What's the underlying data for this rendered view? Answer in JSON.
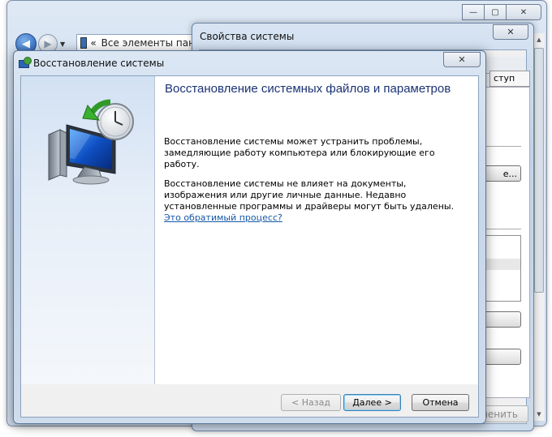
{
  "control_panel": {
    "address_text": "Все элементы панел",
    "address_chevron": "«"
  },
  "system_properties": {
    "title": "Свойства системы",
    "tab_fragment": "ступ",
    "button_fragment": "е...",
    "apply_label": "Применить"
  },
  "system_restore": {
    "title": "Восстановление системы",
    "heading": "Восстановление системных файлов и параметров",
    "paragraph1": "Восстановление системы может устранить проблемы, замедляющие работу компьютера или блокирующие его работу.",
    "paragraph2": "Восстановление системы не влияет на документы, изображения или другие личные данные. Недавно установленные программы и драйверы могут быть удалены.",
    "link": "Это обратимый процесс?",
    "buttons": {
      "back": "< Назад",
      "next": "Далее >",
      "cancel": "Отмена"
    }
  },
  "glyphs": {
    "close": "✕",
    "minimize": "—",
    "maximize": "▢",
    "back_arrow": "◀",
    "forward_arrow": "▶",
    "dropdown": "▼",
    "scroll_up": "▲",
    "scroll_down": "▼"
  }
}
